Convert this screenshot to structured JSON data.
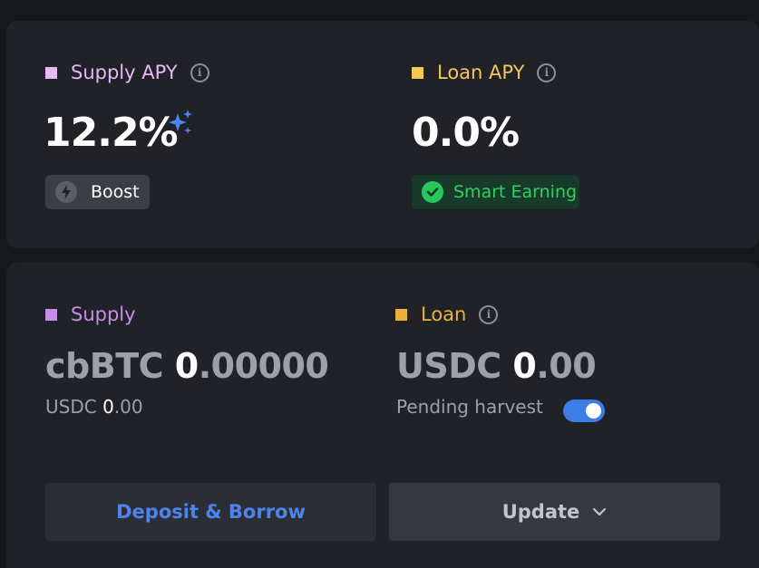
{
  "apy": {
    "supply": {
      "label": "Supply APY",
      "value": "12.2%",
      "badge": "Boost",
      "color": "#e6b8f5"
    },
    "loan": {
      "label": "Loan APY",
      "value": "0.0%",
      "badge": "Smart Earning",
      "color": "#f6c756"
    }
  },
  "position": {
    "supply": {
      "label": "Supply",
      "color": "#c58ee8",
      "asset": "cbBTC",
      "amount_int": "0",
      "amount_dec": ".00000",
      "sub_asset": "USDC",
      "sub_int": "0",
      "sub_dec": ".00"
    },
    "loan": {
      "label": "Loan",
      "color": "#e8b23c",
      "asset": "USDC",
      "amount_int": "0",
      "amount_dec": ".00",
      "pending_label": "Pending harvest",
      "pending_on": true
    }
  },
  "actions": {
    "deposit_label": "Deposit & Borrow",
    "update_label": "Update"
  }
}
